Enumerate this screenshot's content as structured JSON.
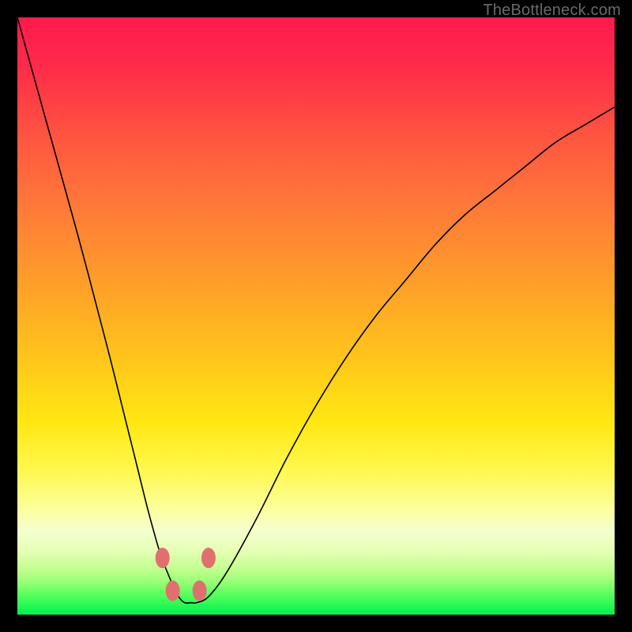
{
  "watermark": "TheBottleneck.com",
  "chart_data": {
    "type": "line",
    "title": "",
    "xlabel": "",
    "ylabel": "",
    "xlim": [
      0,
      100
    ],
    "ylim": [
      0,
      100
    ],
    "grid": false,
    "legend": false,
    "series": [
      {
        "name": "bottleneck-curve",
        "x": [
          0,
          5,
          10,
          15,
          18,
          20,
          22,
          24,
          26,
          27,
          28,
          29,
          30,
          32,
          35,
          40,
          45,
          50,
          55,
          60,
          65,
          70,
          75,
          80,
          85,
          90,
          95,
          100
        ],
        "y": [
          100,
          82,
          64,
          45,
          33,
          25,
          17,
          10,
          5,
          3,
          2,
          2,
          2,
          3,
          7,
          16,
          26,
          35,
          43,
          50,
          56,
          62,
          67,
          71,
          75,
          79,
          82,
          85
        ]
      }
    ],
    "markers": [
      {
        "name": "bump-left-upper",
        "x": 24.3,
        "y": 9.5
      },
      {
        "name": "bump-right-upper",
        "x": 32.0,
        "y": 9.5
      },
      {
        "name": "bump-left-lower",
        "x": 26.0,
        "y": 4.0
      },
      {
        "name": "bump-right-lower",
        "x": 30.5,
        "y": 4.0
      }
    ],
    "gradient_stops": [
      {
        "pos": 0.0,
        "color": "#ff1a4d"
      },
      {
        "pos": 0.5,
        "color": "#ffd020"
      },
      {
        "pos": 0.82,
        "color": "#fbff90"
      },
      {
        "pos": 1.0,
        "color": "#00f050"
      }
    ]
  }
}
